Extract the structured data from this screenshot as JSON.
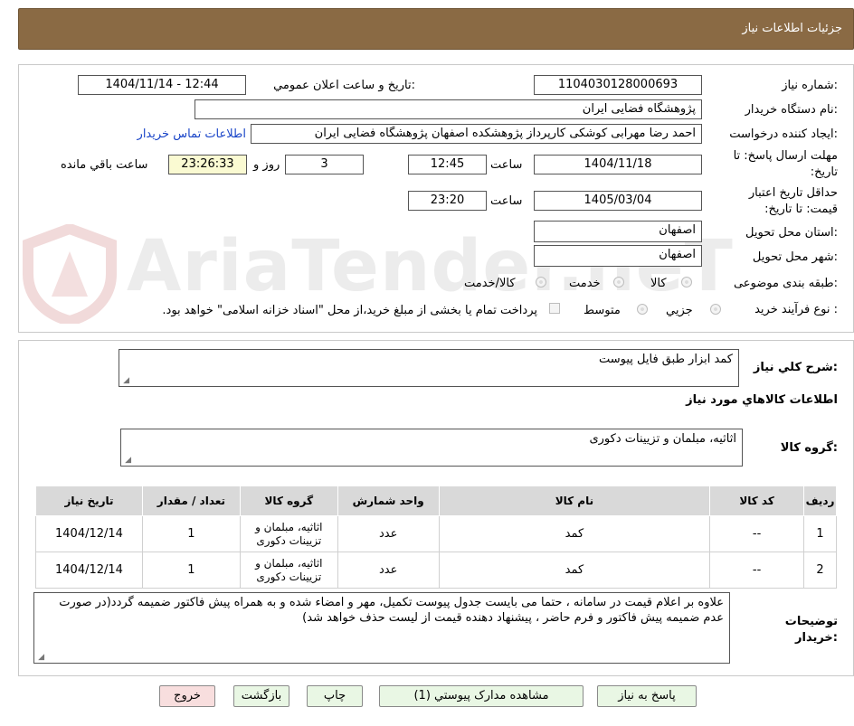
{
  "header": {
    "title": "جزئیات اطلاعات نیاز"
  },
  "watermark": {
    "text": "AriaTender.neT"
  },
  "fields": {
    "need_number": {
      "label": "شماره نیاز:",
      "value": "1104030128000693"
    },
    "announce_datetime": {
      "label": "تاریخ و ساعت اعلان عمومي:",
      "value": "1404/11/14 - 12:44"
    },
    "buyer_org": {
      "label": "نام دستگاه خریدار:",
      "value": "پژوهشگاه فضایی ایران"
    },
    "requester": {
      "label": "ایجاد کننده درخواست:",
      "value": "احمد رضا مهرابی کوشکی کارپرداز پژوهشکده اصفهان پژوهشگاه فضایی ایران",
      "contact_link": "اطلاعات تماس خریدار"
    },
    "reply_deadline": {
      "label": "مهلت ارسال پاسخ: تا تاریخ:",
      "date": "1404/11/18",
      "time_label": "ساعت",
      "time": "12:45",
      "days": "3",
      "days_label": "روز و",
      "remaining": "23:26:33",
      "remaining_label": "ساعت باقي مانده"
    },
    "price_validity": {
      "label": "حداقل تاریخ اعتبار قیمت: تا تاریخ:",
      "date": "1405/03/04",
      "time_label": "ساعت",
      "time": "23:20"
    },
    "province": {
      "label": "استان محل تحویل:",
      "value": "اصفهان"
    },
    "city": {
      "label": "شهر محل تحویل:",
      "value": "اصفهان"
    },
    "category": {
      "label": "طبقه بندی موضوعی:",
      "options": [
        "کالا",
        "خدمت",
        "کالا/خدمت"
      ]
    },
    "purchase_type": {
      "label": "نوع فرآیند خرید :",
      "options": [
        "جزیي",
        "متوسط"
      ],
      "note": "پرداخت تمام یا بخشی از مبلغ خرید،از محل \"اسناد خزانه اسلامی\" خواهد بود."
    }
  },
  "summary": {
    "label": "شرح کلي نیاز:",
    "value": "کمد ابزار طبق فایل پیوست"
  },
  "goods_section": {
    "title": "اطلاعات کالاهاي مورد نیاز",
    "group_label": "گروه کالا:",
    "group_value": "اثاثیه، مبلمان و تزیینات دکوری"
  },
  "table": {
    "headers": [
      "ردیف",
      "کد کالا",
      "نام کالا",
      "واحد شمارش",
      "گروه کالا",
      "تعداد / مقدار",
      "تاریخ نیاز"
    ],
    "rows": [
      [
        "1",
        "--",
        "کمد",
        "عدد",
        "اثاثیه، مبلمان و تزیینات دکوری",
        "1",
        "1404/12/14"
      ],
      [
        "2",
        "--",
        "کمد",
        "عدد",
        "اثاثیه، مبلمان و تزیینات دکوری",
        "1",
        "1404/12/14"
      ]
    ]
  },
  "buyer_notes": {
    "label_line1": "توضیحات",
    "label_line2": "خریدار:",
    "value": "علاوه بر اعلام قیمت در سامانه ، حتما می بایست جدول پیوست تکمیل، مهر و امضاء شده و به همراه پیش فاکتور ضمیمه گردد(در صورت عدم ضمیمه پیش فاکتور و فرم حاضر ، پیشنهاد دهنده قیمت از لیست حذف خواهد شد)"
  },
  "buttons": {
    "reply": "پاسخ به نیاز",
    "attachments": "مشاهده مدارک پیوستي (1)",
    "print": "چاپ",
    "back": "بازگشت",
    "exit": "خروج"
  },
  "colors": {
    "header_bg": "#8a6a44",
    "link": "#1a45c8",
    "remaining_bg": "#fafad2",
    "green_btn": "#e9f7e4",
    "pink_btn": "#f8dede"
  }
}
